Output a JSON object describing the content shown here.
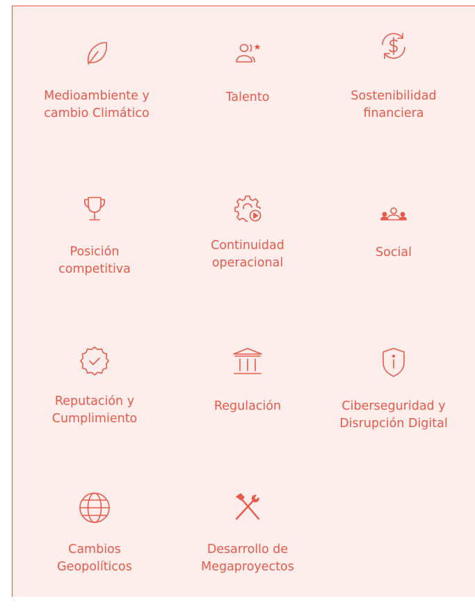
{
  "accent_color": "#e8594a",
  "background_color": "#fdeeec",
  "risk_categories": [
    {
      "label": "Medioambiente y\ncambio Climático",
      "icon": "leaf-icon"
    },
    {
      "label": "Talento",
      "icon": "people-star-icon"
    },
    {
      "label": "Sostenibilidad\nfinanciera",
      "icon": "dollar-cycle-icon"
    },
    {
      "label": "Posición\ncompetitiva",
      "icon": "trophy-icon"
    },
    {
      "label": "Continuidad\noperacional",
      "icon": "gear-play-icon"
    },
    {
      "label": "Social",
      "icon": "group-icon"
    },
    {
      "label": "Reputación y\nCumplimiento",
      "icon": "badge-check-icon"
    },
    {
      "label": "Regulación",
      "icon": "institution-icon"
    },
    {
      "label": "Ciberseguridad y\nDisrupción Digital",
      "icon": "shield-info-icon"
    },
    {
      "label": "Cambios\nGeopolíticos",
      "icon": "globe-icon"
    },
    {
      "label": "Desarrollo de\nMegaproyectos",
      "icon": "tools-icon"
    }
  ]
}
